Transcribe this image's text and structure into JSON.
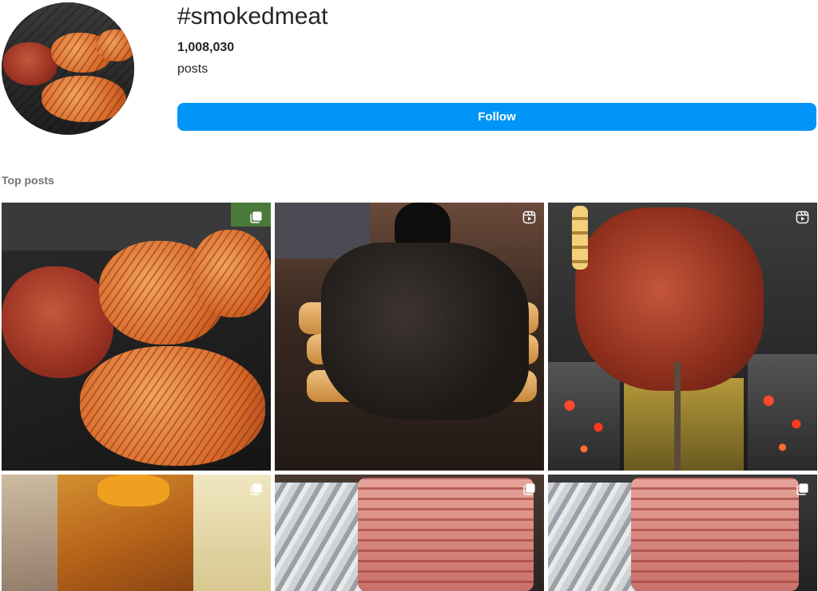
{
  "header": {
    "hashtag": "#smokedmeat",
    "post_count": "1,008,030",
    "post_label": "posts",
    "follow_label": "Follow"
  },
  "section": {
    "label": "Top posts"
  },
  "colors": {
    "follow_button": "#0095f6",
    "text_primary": "#262626",
    "text_secondary": "#737373"
  },
  "posts": [
    {
      "badge_icon": "multi-photo-icon"
    },
    {
      "badge_icon": "reel-icon"
    },
    {
      "badge_icon": "reel-icon"
    },
    {
      "badge_icon": "multi-photo-icon"
    },
    {
      "badge_icon": "multi-photo-icon"
    },
    {
      "badge_icon": "multi-photo-icon"
    }
  ]
}
